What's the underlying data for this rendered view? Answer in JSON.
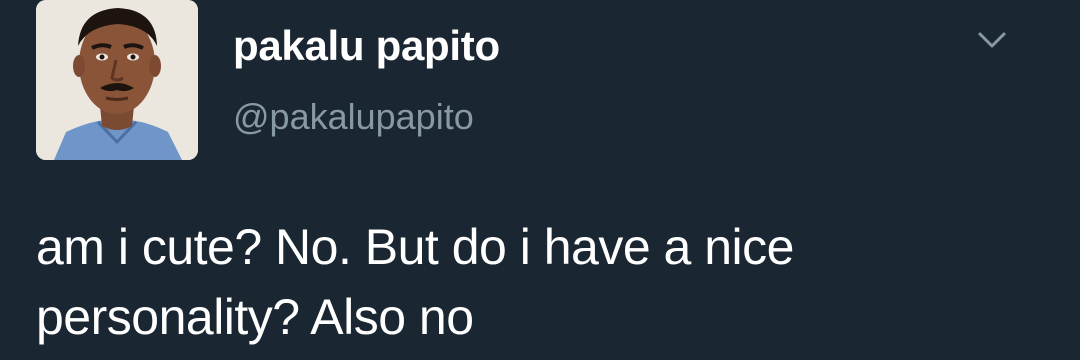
{
  "tweet": {
    "display_name": "pakalu papito",
    "handle": "@pakalupapito",
    "text_line1": "am i cute? No. But do i have a nice",
    "text_line2": "personality? Also no",
    "menu_icon": "chevron-down-icon"
  },
  "colors": {
    "background": "#1a2631",
    "name": "#ffffff",
    "handle": "#8899a6",
    "text": "#ffffff",
    "chevron": "#8899a6"
  }
}
